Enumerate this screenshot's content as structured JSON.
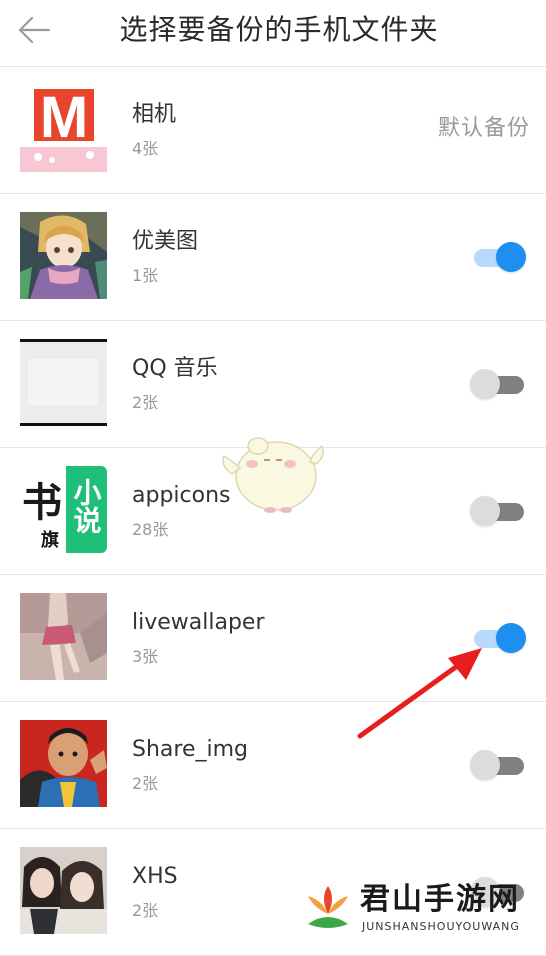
{
  "header": {
    "title": "选择要备份的手机文件夹"
  },
  "folders": [
    {
      "name": "相机",
      "count": "4张",
      "status_label": "默认备份",
      "thumb_icon": "m-logo-thumbnail"
    },
    {
      "name": "优美图",
      "count": "1张",
      "toggle_on": true,
      "thumb_icon": "anime-girl-thumbnail"
    },
    {
      "name": "QQ 音乐",
      "count": "2张",
      "toggle_on": false,
      "thumb_icon": "blank-image-thumbnail"
    },
    {
      "name": "appicons",
      "count": "28张",
      "toggle_on": false,
      "thumb_icon": "novel-app-icon-thumbnail"
    },
    {
      "name": "livewallaper",
      "count": "3张",
      "toggle_on": true,
      "thumb_icon": "wallpaper-thumbnail"
    },
    {
      "name": "Share_img",
      "count": "2张",
      "toggle_on": false,
      "thumb_icon": "cartoon-man-thumbnail"
    },
    {
      "name": "XHS",
      "count": "2张",
      "toggle_on": false,
      "thumb_icon": "photo-girls-thumbnail"
    }
  ],
  "thumb_texts": {
    "m_logo": "M",
    "novel_left": "书",
    "novel_sub": "旗",
    "novel_right": "小说"
  },
  "watermark": {
    "title": "君山手游网",
    "subtitle": "JUNSHANSHOUYOUWANG"
  },
  "colors": {
    "toggle_on": "#1e8ff0",
    "toggle_on_track": "#b7d9fb",
    "toggle_off_track": "#808080",
    "annotation_arrow": "#e61e1e"
  }
}
